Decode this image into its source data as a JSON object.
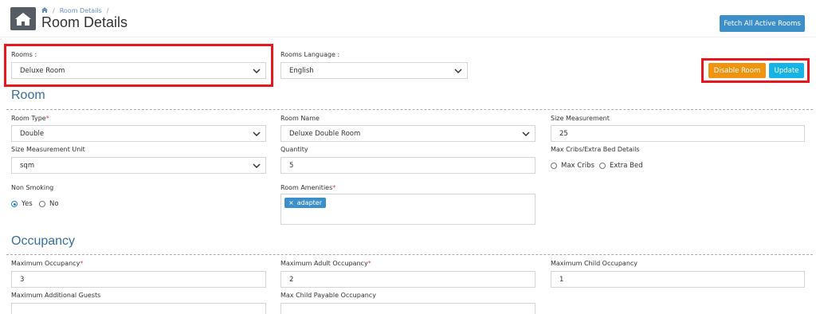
{
  "header": {
    "breadcrumb": [
      "Room Details"
    ],
    "title": "Room Details",
    "fetch_button": "Fetch All Active Rooms"
  },
  "top": {
    "rooms_label": "Rooms :",
    "rooms_value": "Deluxe Room",
    "language_label": "Rooms Language :",
    "language_value": "English",
    "disable_button": "Disable Room",
    "update_button": "Update"
  },
  "room": {
    "section_title": "Room",
    "room_type_label": "Room Type",
    "room_type_value": "Double",
    "room_name_label": "Room Name",
    "room_name_value": "Deluxe Double Room",
    "size_measurement_label": "Size Measurement",
    "size_measurement_value": "25",
    "size_unit_label": "Size Measurement Unit",
    "size_unit_value": "sqm",
    "quantity_label": "Quantity",
    "quantity_value": "5",
    "max_cribs_label": "Max Cribs/Extra Bed Details",
    "max_cribs_option": "Max Cribs",
    "extra_bed_option": "Extra Bed",
    "non_smoking_label": "Non Smoking",
    "yes_option": "Yes",
    "no_option": "No",
    "amenities_label": "Room Amenities",
    "amenity_tag_remove": "×",
    "amenity_tag": "adapter"
  },
  "occupancy": {
    "section_title": "Occupancy",
    "max_occupancy_label": "Maximum Occupancy",
    "max_occupancy_value": "3",
    "max_adult_label": "Maximum Adult Occupancy",
    "max_adult_value": "2",
    "max_child_label": "Maximum Child Occupancy",
    "max_child_value": "1",
    "max_additional_label": "Maximum Additional Guests",
    "max_child_payable_label": "Max Child Payable Occupancy"
  },
  "required_marker": "*",
  "colors": {
    "primary": "#3d8fc9",
    "warning": "#f0930f",
    "info": "#16b4e6",
    "highlight": "#e8171d",
    "section_title": "#3a6e9f"
  }
}
